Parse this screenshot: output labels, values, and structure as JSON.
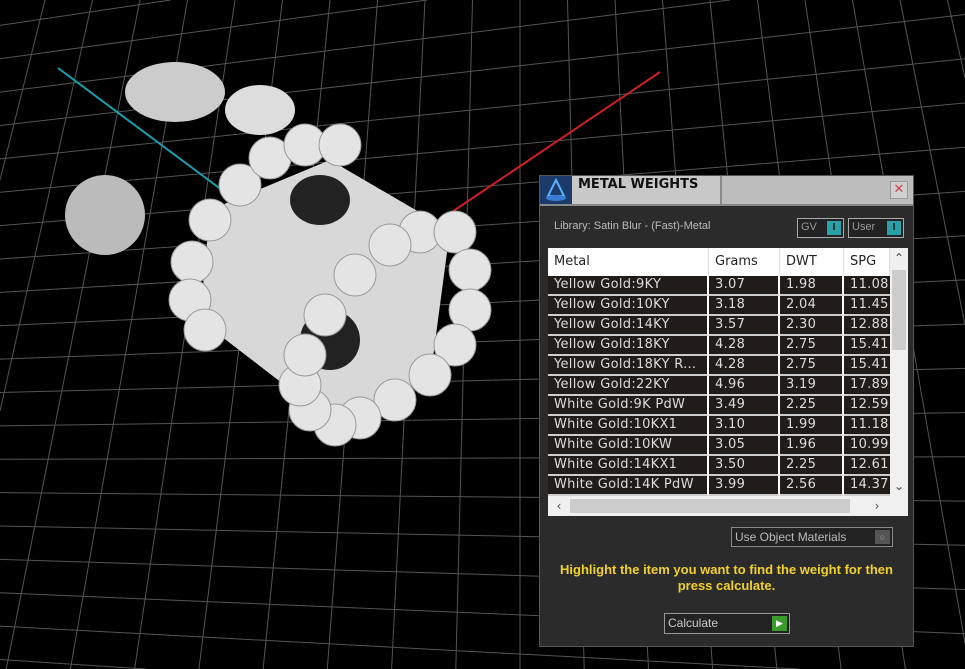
{
  "panel": {
    "title": "METAL WEIGHTS",
    "close": "✕",
    "library": "Library: Satin Blur - (Fast)-Metal",
    "toggles": [
      {
        "label": "GV",
        "state": "I"
      },
      {
        "label": "User",
        "state": "I"
      }
    ],
    "columns": [
      "Metal",
      "Grams",
      "DWT",
      "SPG"
    ],
    "rows": [
      [
        "Yellow Gold:9KY",
        "3.07",
        "1.98",
        "11.08"
      ],
      [
        "Yellow Gold:10KY",
        "3.18",
        "2.04",
        "11.45"
      ],
      [
        "Yellow Gold:14KY",
        "3.57",
        "2.30",
        "12.88"
      ],
      [
        "Yellow Gold:18KY",
        "4.28",
        "2.75",
        "15.41"
      ],
      [
        "Yellow Gold:18KY R...",
        "4.28",
        "2.75",
        "15.41"
      ],
      [
        "Yellow Gold:22KY",
        "4.96",
        "3.19",
        "17.89"
      ],
      [
        "White Gold:9K PdW",
        "3.49",
        "2.25",
        "12.59"
      ],
      [
        "White Gold:10KX1",
        "3.10",
        "1.99",
        "11.18"
      ],
      [
        "White Gold:10KW",
        "3.05",
        "1.96",
        "10.99"
      ],
      [
        "White Gold:14KX1",
        "3.50",
        "2.25",
        "12.61"
      ],
      [
        "White Gold:14K PdW",
        "3.99",
        "2.56",
        "14.37"
      ]
    ],
    "use_object_materials": "Use Object Materials",
    "message": "Highlight the item you want to find the weight for then press calculate.",
    "calculate": "Calculate"
  },
  "colors": {
    "accent": "#2aa0a8",
    "message": "#f2d22a",
    "go": "#3a9a2a"
  }
}
